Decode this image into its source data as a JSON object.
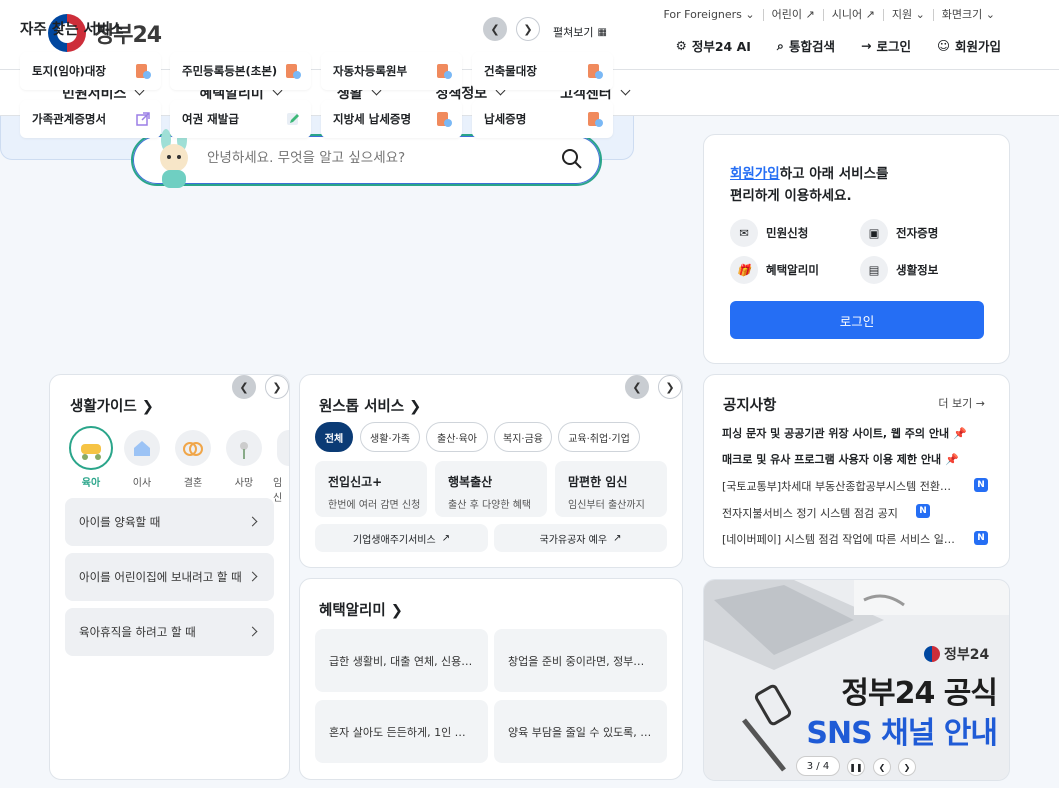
{
  "header": {
    "logo_text": "정부24",
    "util": [
      "For Foreigners",
      "어린이",
      "시니어",
      "지원",
      "화면크기"
    ],
    "top_links": [
      "정부24 AI",
      "통합검색",
      "로그인",
      "회원가입"
    ]
  },
  "nav": [
    "민원서비스",
    "혜택알리미",
    "생활",
    "정책정보",
    "고객센터"
  ],
  "search": {
    "placeholder": "안녕하세요. 무엇을 알고 싶으세요?"
  },
  "favorites": {
    "title": "자주 찾는 서비스",
    "expand": "펼쳐보기",
    "items": [
      "토지(임야)대장",
      "주민등록등본(초본)",
      "자동차등록원부",
      "건축물대장",
      "가족관계증명서",
      "여권 재발급",
      "지방세 납세증명",
      "납세증명"
    ]
  },
  "login": {
    "line1_link": "회원가입",
    "line1_rest": "하고 아래 서비스를",
    "line2": "편리하게 이용하세요.",
    "services": [
      "민원신청",
      "전자증명",
      "혜택알리미",
      "생활정보"
    ],
    "button": "로그인"
  },
  "guide": {
    "title": "생활가이드",
    "icons": [
      "육아",
      "이사",
      "결혼",
      "사망",
      "임신"
    ],
    "items": [
      "아이를 양육할 때",
      "아이를 어린이집에 보내려고 할 때",
      "육아휴직을 하려고 할 때"
    ]
  },
  "onestop": {
    "title": "원스톱 서비스",
    "tabs": [
      "전체",
      "생활·가족",
      "출산·육아",
      "복지·금융",
      "교육·취업·기업"
    ],
    "cards": [
      {
        "title": "전입신고+",
        "desc": "한번에 여러 감면 신청"
      },
      {
        "title": "행복출산",
        "desc": "출산 후 다양한 혜택"
      },
      {
        "title": "맘편한 임신",
        "desc": "임신부터 출산까지"
      }
    ],
    "links": [
      "기업생애주기서비스",
      "국가유공자 예우"
    ]
  },
  "benefit": {
    "title": "혜택알리미",
    "items": [
      "급한 생활비, 대출 연체, 신용…",
      "창업을 준비 중이라면, 정부…",
      "혼자 살아도 든든하게, 1인 …",
      "양육 부담을 줄일 수 있도록, …"
    ]
  },
  "notice": {
    "title": "공지사항",
    "more": "더 보기",
    "items": [
      {
        "text": "피싱 문자 및 공공기관 위장 사이트, 웹 주의 안내",
        "pinned": true
      },
      {
        "text": "매크로 및 유사 프로그램 사용자 이용 제한 안내",
        "pinned": true
      },
      {
        "text": "[국토교통부]차세대 부동산종합공부시스템 전환…",
        "badge": "N"
      },
      {
        "text": "전자지불서비스 정기 시스템 점검 공지",
        "badge": "N"
      },
      {
        "text": "[네이버페이] 시스템 점검 작업에 따른 서비스 일…",
        "badge": "N"
      }
    ]
  },
  "banner": {
    "logo": "정부24",
    "line1": "정부24 공식",
    "line2": "SNS 채널 안내",
    "pager": "3 / 4"
  }
}
